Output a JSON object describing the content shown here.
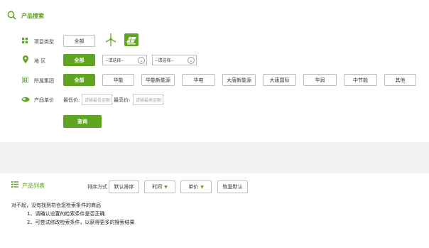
{
  "search_section": {
    "title": "产品搜索",
    "project_type": {
      "label": "项目类型",
      "all_label": "全部",
      "wind_icon": "wind-turbine-icon",
      "solar_icon": "solar-panel-icon"
    },
    "region": {
      "label": "地 区",
      "all_label": "全部",
      "select1": "--请选择--",
      "select2": "--请选择--"
    },
    "group": {
      "label": "所属集团",
      "all_label": "全部",
      "options": [
        "华能",
        "华能新能源",
        "华电",
        "大唐新能源",
        "大唐国际",
        "华润",
        "中节能",
        "其他"
      ]
    },
    "price": {
      "label": "产品单价",
      "min_label": "最低价:",
      "min_placeholder": "请输最低金额",
      "max_label": "最高价:",
      "max_placeholder": "请输最高金额"
    },
    "search_button": "查询"
  },
  "list_section": {
    "title": "产品列表",
    "sort_label": "排序方式",
    "sort_options": {
      "default": "默认排序",
      "time": "时间",
      "price": "单价",
      "reset": "恢复默认"
    },
    "empty_message": {
      "line1": "对不起，没有找到符合您检索条件的商品",
      "line2": "1、请确认设置的检索条件是否正确",
      "line3": "2、可尝试修改检索条件，以获得更多的搜索结果"
    }
  },
  "colors": {
    "accent": "#5fa521",
    "title_green": "#5a9e1a",
    "background": "#f2f2f2"
  }
}
